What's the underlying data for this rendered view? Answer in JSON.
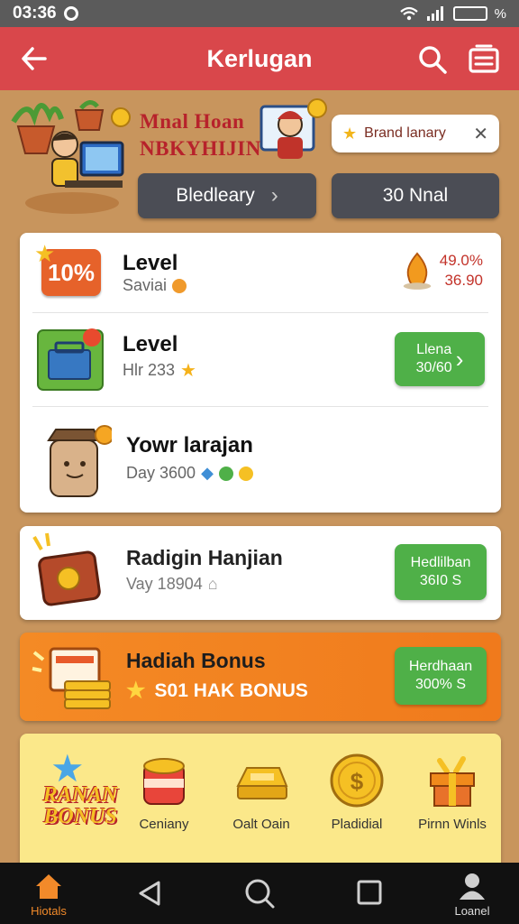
{
  "status_bar": {
    "time": "03:36",
    "battery": "%"
  },
  "app_bar": {
    "title": "Kerlugan"
  },
  "hero": {
    "headline_line1": "Mnal Hoan",
    "headline_line2": "NBKYHIJIN",
    "pill_label": "Brand lanary",
    "button_left": "Bledleary",
    "button_right": "30 Nnal"
  },
  "rows": [
    {
      "icon_text": "10%",
      "title": "Level",
      "subtitle": "Saviai",
      "pct_line1": "49.0%",
      "pct_line2": "36.90"
    },
    {
      "title": "Level",
      "subtitle": "Hlr 233",
      "button_line1": "Llena",
      "button_line2": "30/60"
    },
    {
      "title": "Yowr larajan",
      "subtitle": "Day 3600"
    }
  ],
  "reward_card": {
    "title": "Radigin Hanjian",
    "subtitle": "Vay 18904",
    "button_line1": "Hedlilban",
    "button_line2": "36I0 S"
  },
  "bonus_card": {
    "title": "Hadiah Bonus",
    "subtitle": "S01 HAK BONUS",
    "button_line1": "Herdhaan",
    "button_line2": "300% S"
  },
  "bonus_strip": {
    "badge_line1": "RANAN",
    "badge_line2": "BONUS",
    "items": [
      {
        "label": "Ceniany"
      },
      {
        "label": "Oalt Oain"
      },
      {
        "label": "Pladidial"
      },
      {
        "label": "Pirnn Winls"
      }
    ]
  },
  "nav": {
    "home_label": "Hiotals",
    "account_label": "Loanel"
  },
  "colors": {
    "app_bar": "#d9474b",
    "background": "#c8955d",
    "green": "#4fb048",
    "orange": "#f48a25",
    "yellow_panel": "#fbe88a"
  }
}
